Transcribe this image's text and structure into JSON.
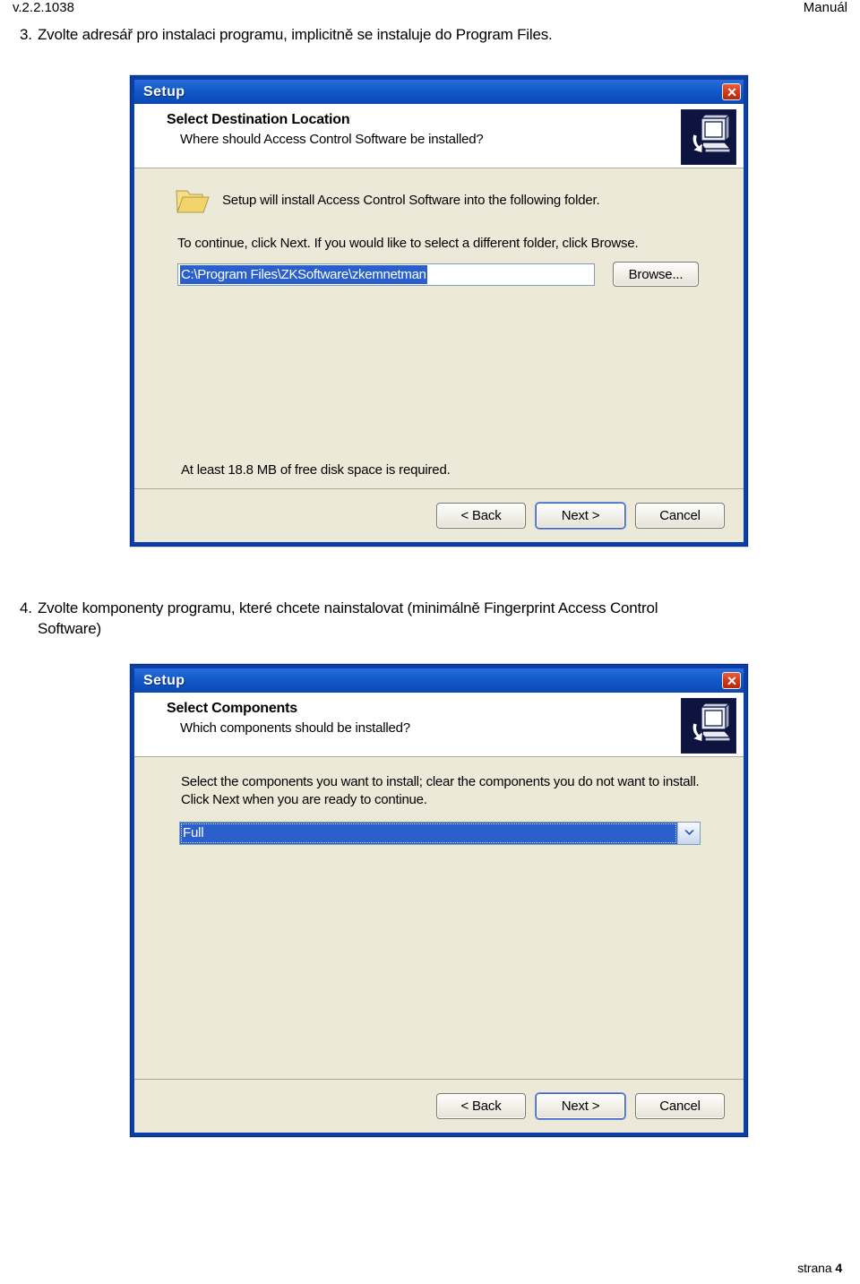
{
  "page": {
    "header_left": "v.2.2.1038",
    "header_right": "Manuál",
    "footer_label": "strana",
    "footer_page": "4"
  },
  "steps": [
    {
      "number": "3.",
      "text": "Zvolte adresář pro instalaci programu, implicitně se instaluje do Program Files."
    },
    {
      "number": "4.",
      "line1": "Zvolte komponenty programu, které chcete nainstalovat (minimálně Fingerprint Access Control",
      "line2": "Software)"
    }
  ],
  "dialog1": {
    "title": "Setup",
    "close_icon": "close-icon",
    "head_icon": "computer-install-icon",
    "heading": "Select Destination Location",
    "subheading": "Where should Access Control Software be installed?",
    "folder_icon": "folder-icon",
    "folder_text": "Setup will install Access Control Software into the following folder.",
    "hint": "To continue, click Next. If you would like to select a different folder, click Browse.",
    "path_value": "C:\\Program Files\\ZKSoftware\\zkemnetman",
    "browse_label": "Browse...",
    "browse_accel": "r",
    "disk_space": "At least 18.8 MB of free disk space is required.",
    "buttons": {
      "back": "< Back",
      "next": "Next >",
      "cancel": "Cancel"
    }
  },
  "dialog2": {
    "title": "Setup",
    "close_icon": "close-icon",
    "head_icon": "computer-install-icon",
    "heading": "Select Components",
    "subheading": "Which components should be installed?",
    "instructions_line1": "Select the components you want to install; clear the components you do not want to",
    "instructions_line2": "install. Click Next when you are ready to continue.",
    "combo_value": "Full",
    "combo_icon": "chevron-down-icon",
    "buttons": {
      "back": "< Back",
      "next": "Next >",
      "cancel": "Cancel"
    }
  },
  "colors": {
    "title_bar_blue": "#135ecb",
    "dialog_frame_blue": "#0b3fa8",
    "dialog_face": "#ece9d8",
    "selection_blue": "#2a5fcc",
    "close_red": "#d8381a"
  }
}
